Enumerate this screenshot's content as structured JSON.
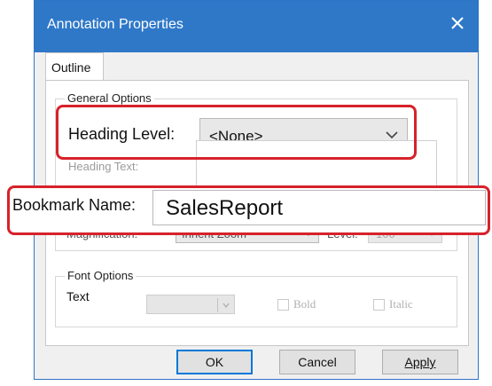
{
  "dialog": {
    "title": "Annotation Properties",
    "tabs": [
      {
        "label": "Outline"
      }
    ],
    "general_options": {
      "title": "General Options",
      "heading_level_label": "Heading Level:",
      "heading_level_value": "<None>",
      "heading_text_label": "Heading Text:",
      "bookmark_name_label": "Bookmark Name:",
      "bookmark_name_value": "SalesReport",
      "magnification_label": "Magnification:",
      "magnification_value": "Inherit Zoom",
      "level_label": "Level:",
      "level_value": "100"
    },
    "font_options": {
      "title": "Font Options",
      "text_label": "Text",
      "bold_label": "Bold",
      "italic_label": "Italic"
    },
    "buttons": {
      "ok": "OK",
      "cancel": "Cancel",
      "apply": "Apply"
    }
  },
  "colors": {
    "titlebar": "#2f78c8",
    "highlight": "#d7222a"
  }
}
